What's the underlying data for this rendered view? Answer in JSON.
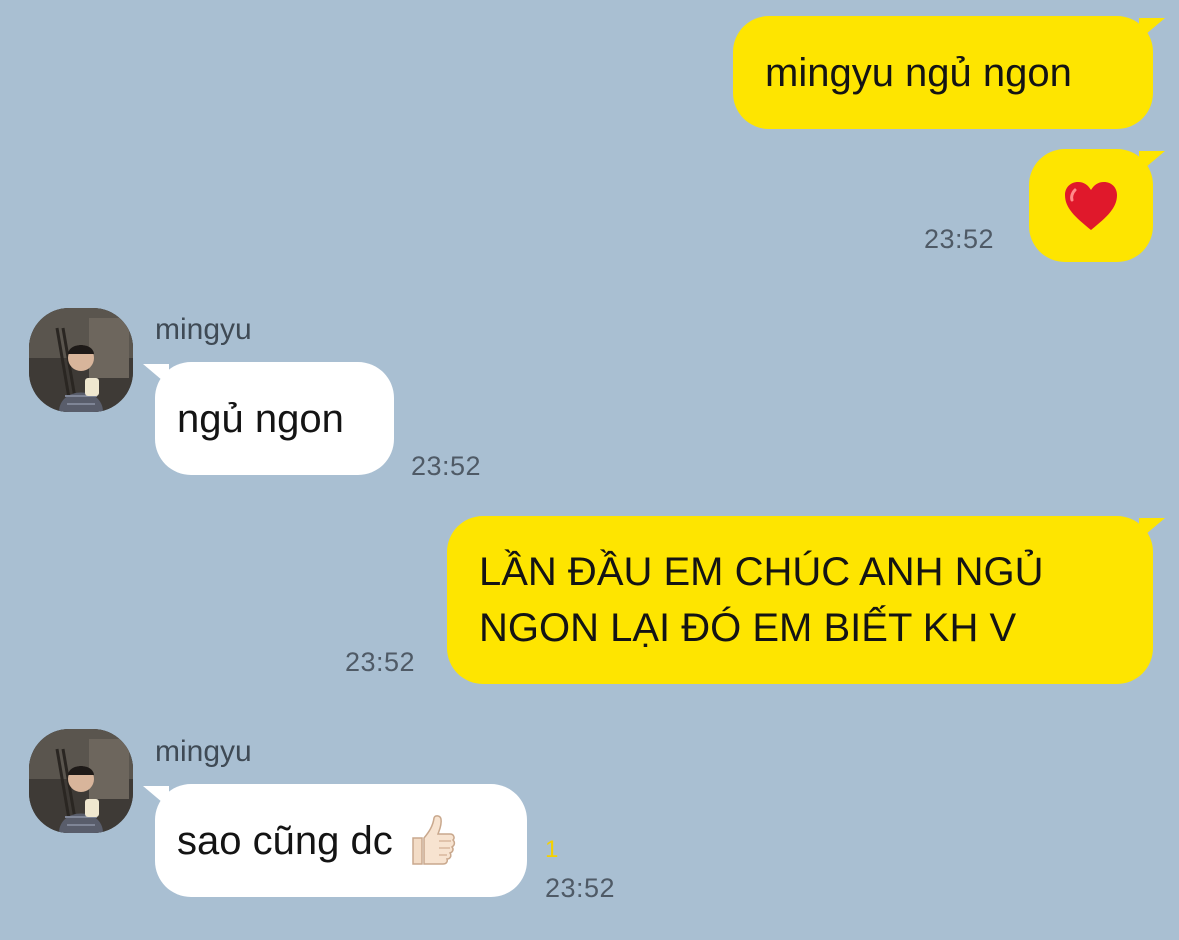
{
  "conversation": {
    "messages": [
      {
        "direction": "outgoing",
        "text": "mingyu ngủ ngon"
      },
      {
        "direction": "outgoing",
        "icon": "red-heart-emoji",
        "time": "23:52"
      },
      {
        "direction": "incoming",
        "sender": "mingyu",
        "text": "ngủ ngon",
        "time": "23:52"
      },
      {
        "direction": "outgoing",
        "lines": [
          "LẦN ĐẦU EM CHÚC ANH NGỦ",
          "NGON LẠI ĐÓ EM BIẾT KH V"
        ],
        "time": "23:52"
      },
      {
        "direction": "incoming",
        "sender": "mingyu",
        "text": "sao cũng dc",
        "icon": "thumbs-up-emoji",
        "unread": "1",
        "time": "23:52"
      }
    ]
  },
  "colors": {
    "background": "#a9bfd2",
    "outgoing_bubble": "#fee500",
    "incoming_bubble": "#ffffff",
    "unread_count": "#f5d100"
  }
}
